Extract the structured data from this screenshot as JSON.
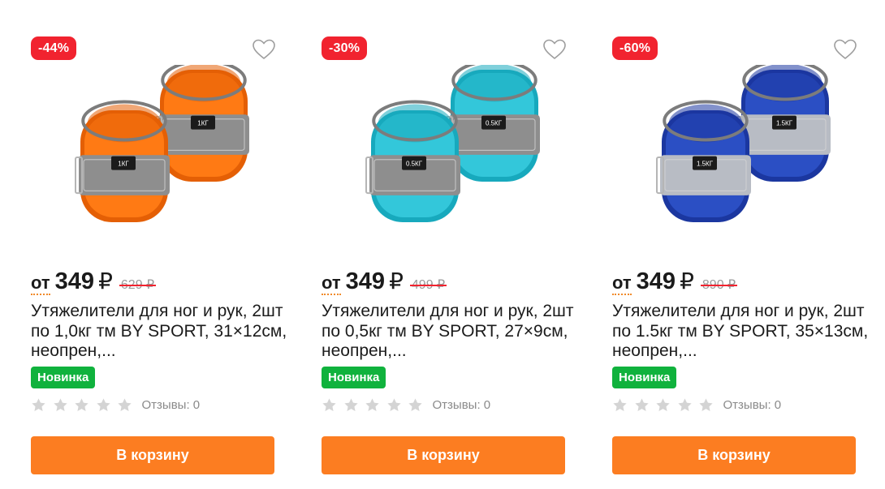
{
  "products": [
    {
      "discount": "-44%",
      "price_prefix": "от",
      "price": "349",
      "currency": "₽",
      "old_price": "629 ₽",
      "title": "Утяжелители для ног и рук, 2шт по 1,0кг тм BY SPORT, 31×12см, неопрен,...",
      "badge": "Новинка",
      "rating": 0,
      "reviews": "Отзывы: 0",
      "cart_label": "В корзину",
      "image_label": "1КГ",
      "colors": {
        "main": "#ff7a14",
        "dark": "#e45f05",
        "strap": "#8e8e8e"
      }
    },
    {
      "discount": "-30%",
      "price_prefix": "от",
      "price": "349",
      "currency": "₽",
      "old_price": "499 ₽",
      "title": "Утяжелители для ног и рук, 2шт по 0,5кг тм BY SPORT, 27×9см, неопрен,...",
      "badge": "Новинка",
      "rating": 0,
      "reviews": "Отзывы: 0",
      "cart_label": "В корзину",
      "image_label": "0.5КГ",
      "colors": {
        "main": "#33c7da",
        "dark": "#17a9bd",
        "strap": "#8e8e8e"
      }
    },
    {
      "discount": "-60%",
      "price_prefix": "от",
      "price": "349",
      "currency": "₽",
      "old_price": "890 ₽",
      "title": "Утяжелители для ног и рук, 2шт по 1.5кг тм BY SPORT, 35×13см, неопрен,...",
      "badge": "Новинка",
      "rating": 0,
      "reviews": "Отзывы: 0",
      "cart_label": "В корзину",
      "image_label": "1.5КГ",
      "colors": {
        "main": "#2b4fc4",
        "dark": "#1b37a0",
        "strap": "#b8bcc4"
      }
    }
  ],
  "theme": {
    "discount_red": "#f1232f",
    "new_green": "#10b23d",
    "cart_orange": "#fc7d21",
    "star_gray": "#d4d4d4"
  }
}
